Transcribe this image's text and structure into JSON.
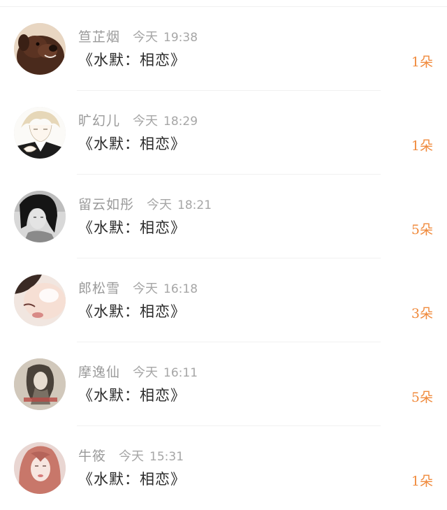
{
  "colors": {
    "name": "#9a9a9a",
    "time": "#a6a6a6",
    "message": "#2a2a2a",
    "count_accent": "#f08a3c",
    "divider": "#f1f1f1"
  },
  "messages": [
    {
      "name": "笪芷烟",
      "day": "今天",
      "time": "19:38",
      "text": "《水默：相恋》",
      "count": "1朵",
      "avatar": "brown-dog-avatar"
    },
    {
      "name": "旷幻儿",
      "day": "今天",
      "time": "18:29",
      "text": "《水默：相恋》",
      "count": "1朵",
      "avatar": "anime-boy-avatar"
    },
    {
      "name": "留云如彤",
      "day": "今天",
      "time": "18:21",
      "text": "《水默：相恋》",
      "count": "5朵",
      "avatar": "bw-girl-avatar"
    },
    {
      "name": "郎松雪",
      "day": "今天",
      "time": "16:18",
      "text": "《水默：相恋》",
      "count": "3朵",
      "avatar": "closeup-face-avatar"
    },
    {
      "name": "摩逸仙",
      "day": "今天",
      "time": "16:11",
      "text": "《水默：相恋》",
      "count": "5朵",
      "avatar": "vintage-photo-avatar"
    },
    {
      "name": "牛筱",
      "day": "今天",
      "time": "15:31",
      "text": "《水默：相恋》",
      "count": "1朵",
      "avatar": "pink-hair-girl-avatar"
    }
  ]
}
